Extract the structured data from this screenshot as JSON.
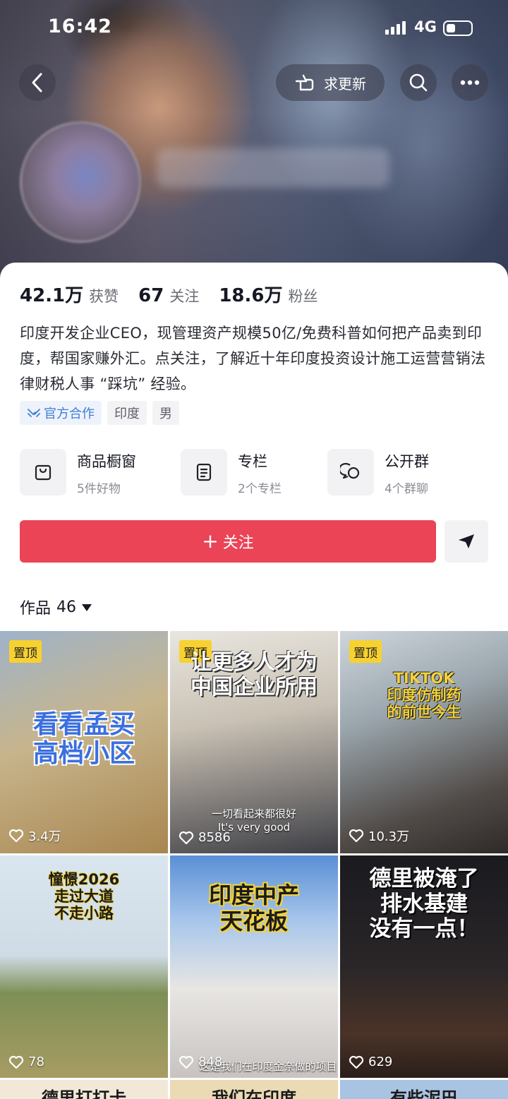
{
  "status_bar": {
    "time": "16:42",
    "network": "4G"
  },
  "header": {
    "update_label": "求更新"
  },
  "stats": [
    {
      "value": "42.1万",
      "label": "获赞"
    },
    {
      "value": "67",
      "label": "关注"
    },
    {
      "value": "18.6万",
      "label": "粉丝"
    }
  ],
  "bio": "印度开发企业CEO，现管理资产规模50亿/免费科普如何把产品卖到印度，帮国家赚外汇。点关注，了解近十年印度投资设计施工运营营销法律财税人事 “踩坑” 经验。",
  "tags": [
    {
      "label": "官方合作",
      "icon": "cooperation-icon"
    },
    {
      "label": "印度"
    },
    {
      "label": "男"
    }
  ],
  "features": [
    {
      "title": "商品橱窗",
      "sub": "5件好物",
      "icon": "shop-bag-icon"
    },
    {
      "title": "专栏",
      "sub": "2个专栏",
      "icon": "column-doc-icon"
    },
    {
      "title": "公开群",
      "sub": "4个群聊",
      "icon": "group-chat-icon"
    }
  ],
  "follow_button": {
    "plus": "+",
    "label": "关注"
  },
  "works": {
    "label": "作品",
    "count": "46"
  },
  "videos": [
    {
      "pinned": "置顶",
      "caption": "看看孟买\n高档小区",
      "likes": "3.4万"
    },
    {
      "pinned": "置顶",
      "caption": "让更多人才为\n中国企业所用",
      "subtitle": "一切看起来都很好\nIt's very good",
      "likes": "8586"
    },
    {
      "pinned": "置顶",
      "caption": "TIKTOK\n印度仿制药\n的前世今生",
      "likes": "10.3万"
    },
    {
      "caption": "憧憬2026\n走过大道\n不走小路",
      "likes": "78"
    },
    {
      "caption": "印度中产\n天花板",
      "subtitle": "这是我们在印度金奈做的项目",
      "likes": "848"
    },
    {
      "caption": "德里被淹了\n排水基建\n没有一点！",
      "likes": "629"
    }
  ],
  "partial_row": [
    "德里打打卡",
    "我们在印度",
    "有些泥巴"
  ]
}
